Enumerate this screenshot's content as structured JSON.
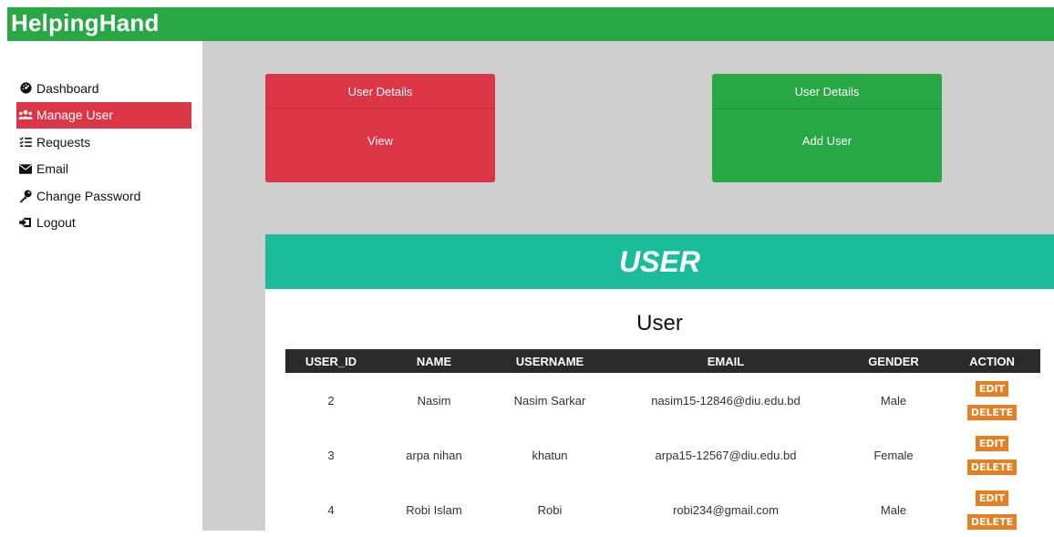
{
  "app": {
    "brand": "HelpingHand"
  },
  "colors": {
    "topbar": "#28a745",
    "active_nav": "#dc3545",
    "panel_header": "#1abc9c",
    "action_button": "#e67e22"
  },
  "sidebar": {
    "items": [
      {
        "label": "Dashboard",
        "icon": "dashboard-icon",
        "active": false
      },
      {
        "label": "Manage User",
        "icon": "users-icon",
        "active": true
      },
      {
        "label": "Requests",
        "icon": "list-icon",
        "active": false
      },
      {
        "label": "Email",
        "icon": "envelope-icon",
        "active": false
      },
      {
        "label": "Change Password",
        "icon": "key-icon",
        "active": false
      },
      {
        "label": "Logout",
        "icon": "sign-out-icon",
        "active": false
      }
    ]
  },
  "cards": [
    {
      "header": "User Details",
      "body": "View"
    },
    {
      "header": "User Details",
      "body": "Add User"
    }
  ],
  "panel": {
    "heading": "USER",
    "title": "User"
  },
  "table": {
    "headers": [
      "USER_ID",
      "NAME",
      "USERNAME",
      "EMAIL",
      "GENDER",
      "ACTION"
    ],
    "rows": [
      {
        "id": "2",
        "name": "Nasim",
        "username": "Nasim Sarkar",
        "email": "nasim15-12846@diu.edu.bd",
        "gender": "Male"
      },
      {
        "id": "3",
        "name": "arpa nihan",
        "username": "khatun",
        "email": "arpa15-12567@diu.edu.bd",
        "gender": "Female"
      },
      {
        "id": "4",
        "name": "Robi Islam",
        "username": "Robi",
        "email": "robi234@gmail.com",
        "gender": "Male"
      }
    ],
    "edit_label": "EDIT",
    "delete_label": "DELETE"
  }
}
